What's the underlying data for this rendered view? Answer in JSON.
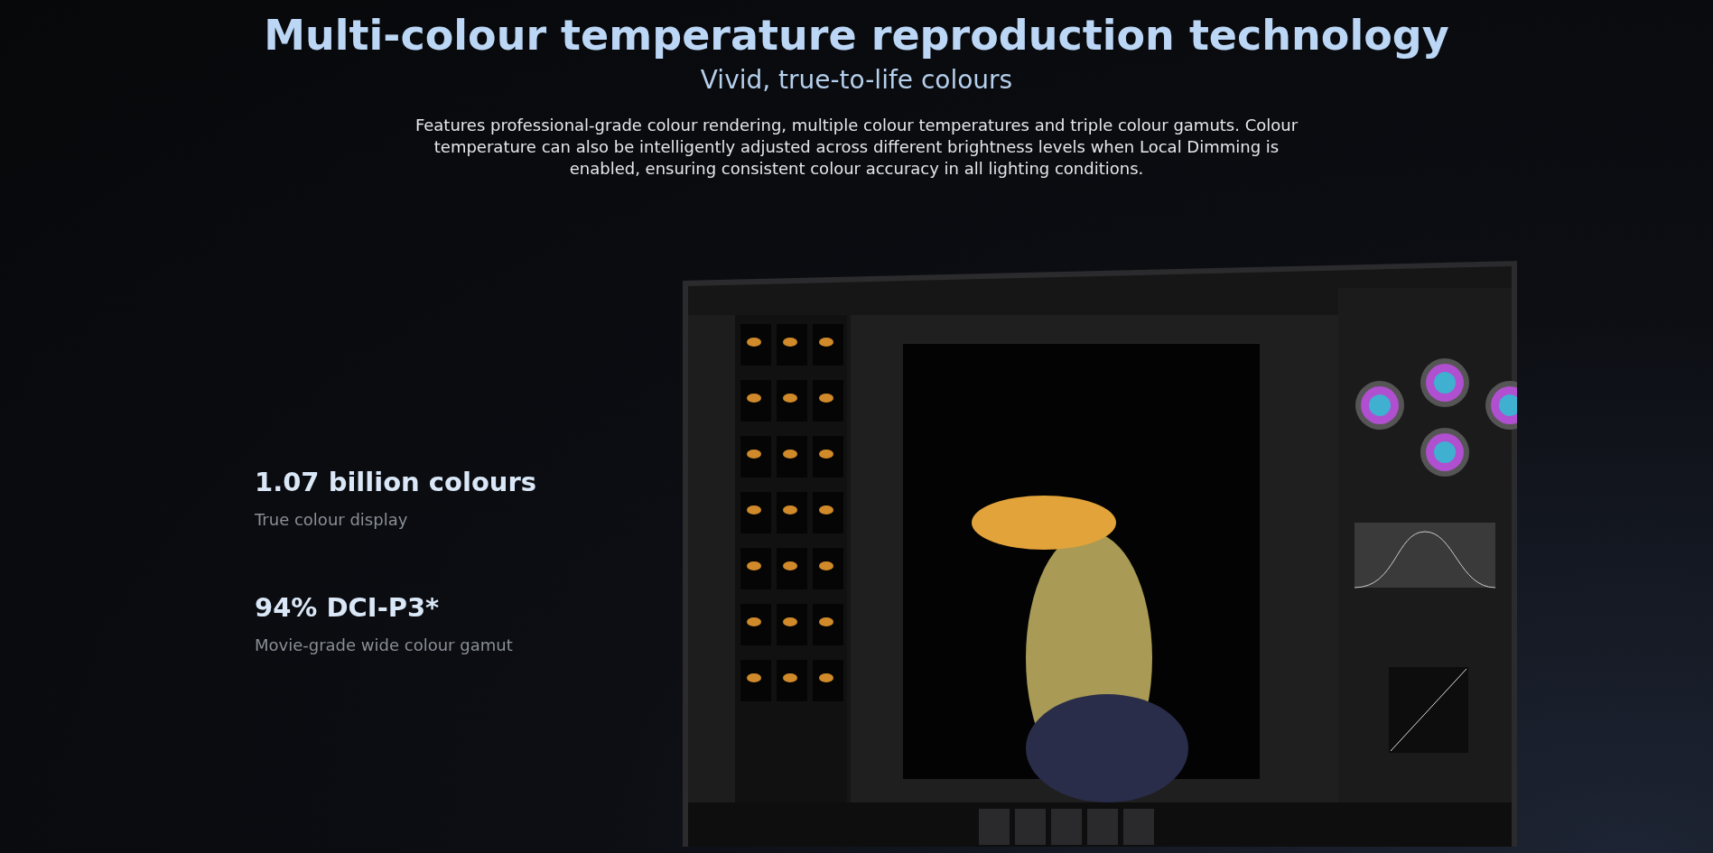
{
  "header": {
    "title": "Multi-colour temperature reproduction technology",
    "subtitle": "Vivid, true-to-life colours",
    "description": "Features professional-grade colour rendering, multiple colour temperatures and triple colour gamuts. Colour temperature can also be intelligently adjusted across different brightness levels when Local Dimming is enabled, ensuring consistent colour accuracy in all lighting conditions."
  },
  "features": [
    {
      "value": "1.07 billion colours",
      "caption": "True colour display"
    },
    {
      "value": "94% DCI-P3*",
      "caption": "Movie-grade wide colour gamut"
    }
  ]
}
